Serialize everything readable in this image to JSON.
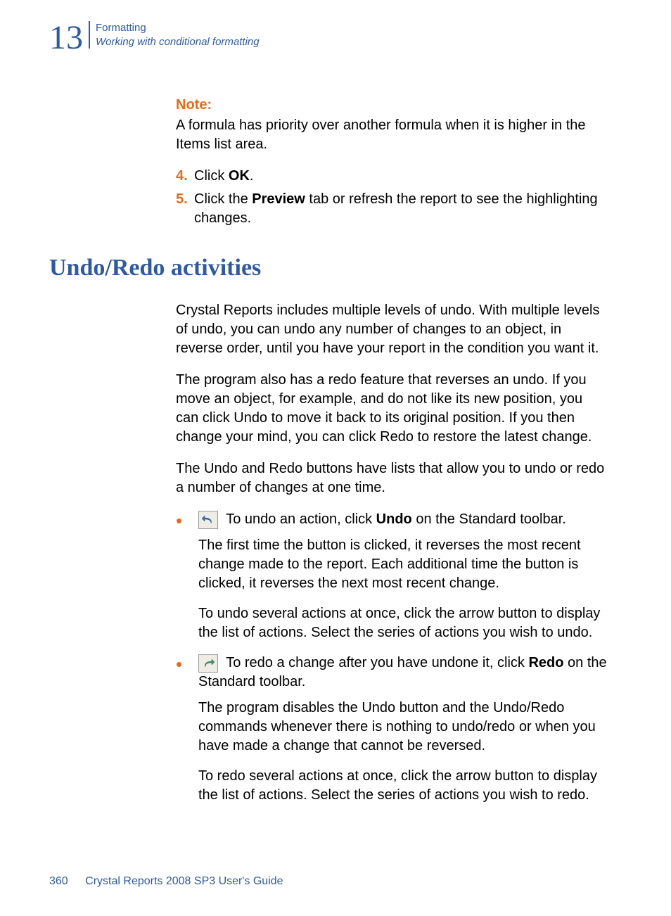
{
  "header": {
    "chapter_number": "13",
    "line1": "Formatting",
    "line2": "Working with conditional formatting"
  },
  "note": {
    "label": "Note:",
    "text": "A formula has priority over another formula when it is higher in the Items list area."
  },
  "steps": [
    {
      "num": "4.",
      "pre": "Click ",
      "bold": "OK",
      "post": "."
    },
    {
      "num": "5.",
      "pre": "Click the ",
      "bold": "Preview",
      "post": " tab or refresh the report to see the highlighting changes."
    }
  ],
  "section_heading": "Undo/Redo activities",
  "paras": {
    "p1": "Crystal Reports includes multiple levels of undo. With multiple levels of undo, you can undo any number of changes to an object, in reverse order, until you have your report in the condition you want it.",
    "p2": "The program also has a redo feature that reverses an undo. If you move an object, for example, and do not like its new position, you can click Undo to move it back to its original position. If you then change your mind, you can click Redo to restore the latest change.",
    "p3": "The Undo and Redo buttons have lists that allow you to undo or redo a number of changes at one time."
  },
  "bullets": [
    {
      "icon": "undo-icon",
      "line_pre": "To undo an action, click ",
      "line_bold": "Undo",
      "line_post": " on the Standard toolbar.",
      "after_paras": [
        "The first time the button is clicked, it reverses the most recent change made to the report. Each additional time the button is clicked, it reverses the next most recent change.",
        "To undo several actions at once, click the arrow button to display the list of actions. Select the series of actions you wish to undo."
      ]
    },
    {
      "icon": "redo-icon",
      "line_pre": "To redo a change after you have undone it, click ",
      "line_bold": "Redo",
      "line_post": " on the Standard toolbar.",
      "after_paras": [
        "The program disables the Undo button and the Undo/Redo commands whenever there is nothing to undo/redo or when you have made a change that cannot be reversed.",
        "To redo several actions at once, click the arrow button to display the list of actions. Select the series of actions you wish to redo."
      ]
    }
  ],
  "footer": {
    "page_number": "360",
    "title": "Crystal Reports 2008 SP3 User's Guide"
  }
}
